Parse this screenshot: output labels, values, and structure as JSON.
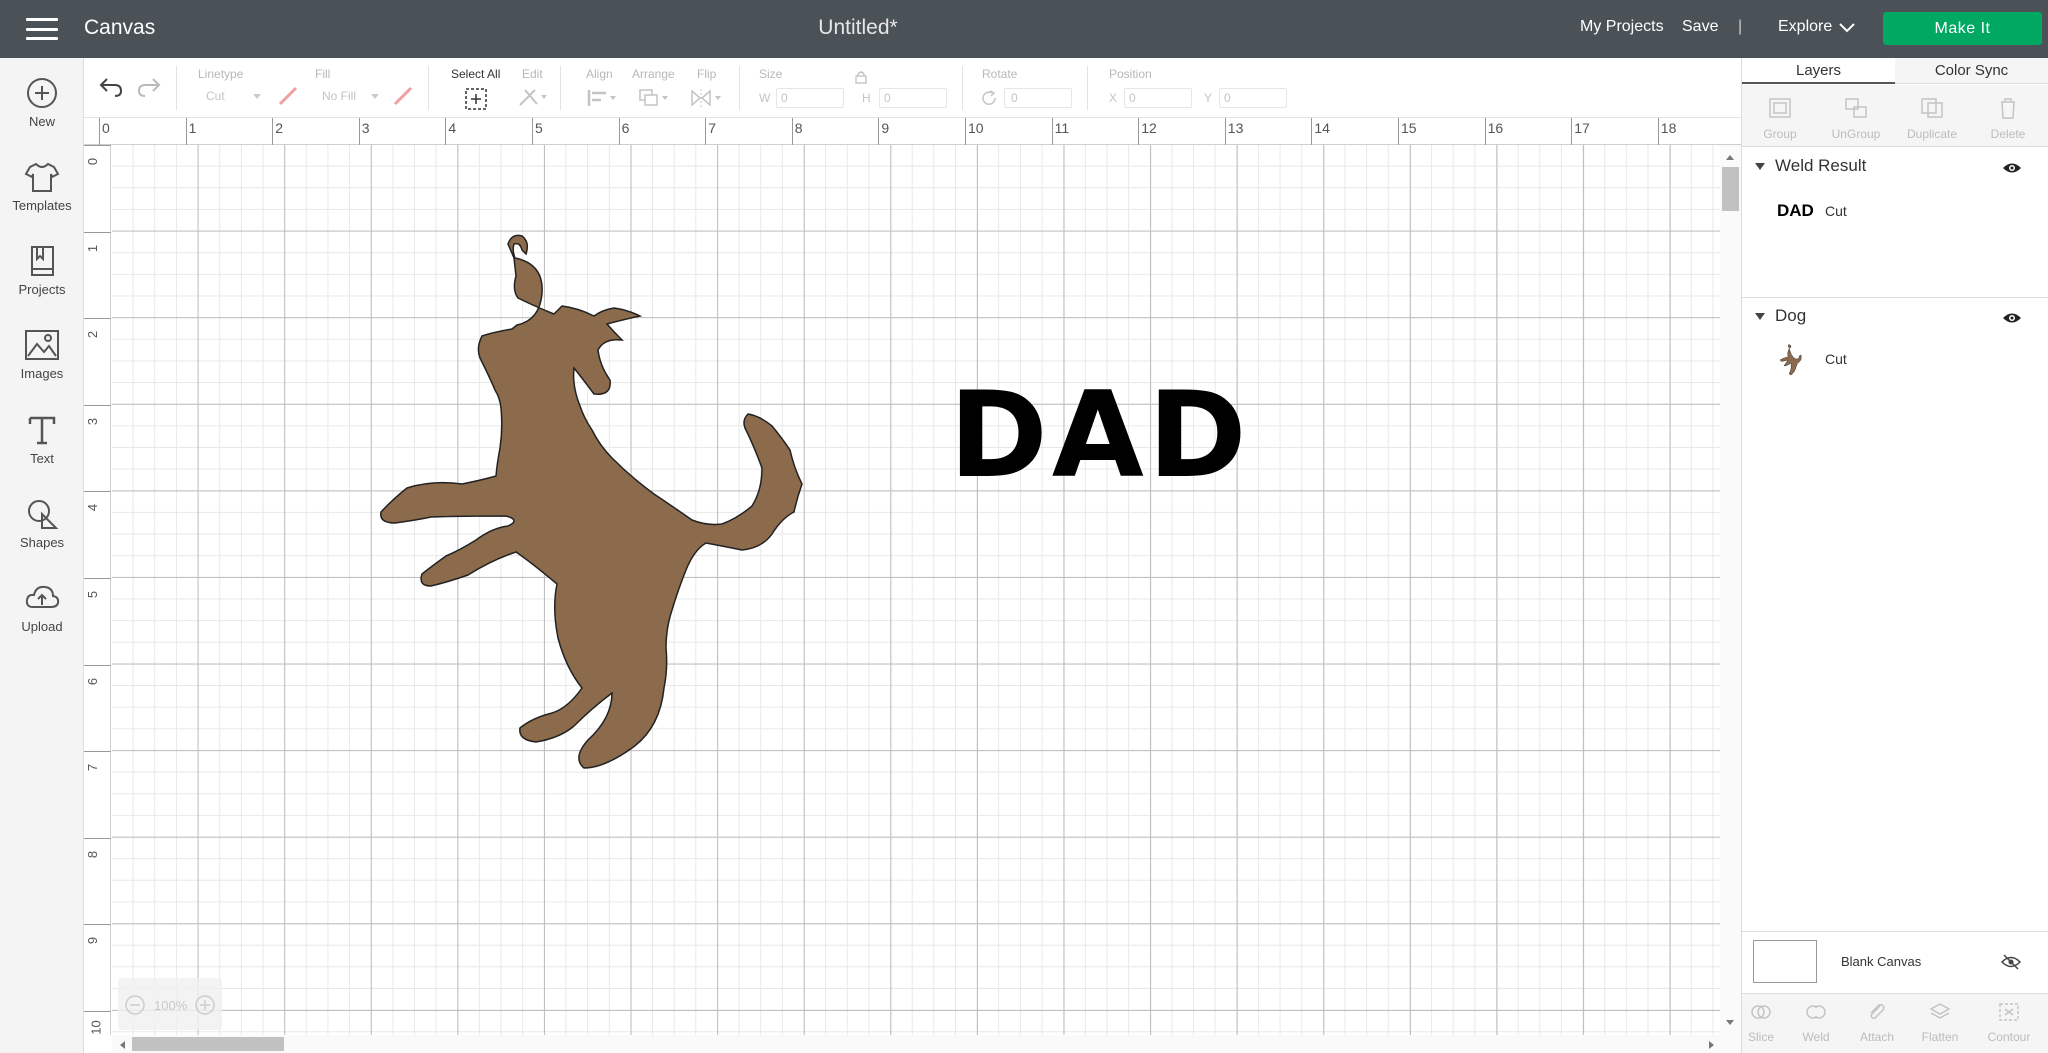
{
  "header": {
    "app_title": "Canvas",
    "doc_title": "Untitled*",
    "my_projects": "My Projects",
    "save": "Save",
    "separator": "|",
    "explore": "Explore",
    "make_it": "Make It"
  },
  "sidebar": {
    "items": [
      {
        "label": "New",
        "icon": "plus-circle-icon"
      },
      {
        "label": "Templates",
        "icon": "shirt-icon"
      },
      {
        "label": "Projects",
        "icon": "bookmark-book-icon"
      },
      {
        "label": "Images",
        "icon": "image-icon"
      },
      {
        "label": "Text",
        "icon": "text-t-icon"
      },
      {
        "label": "Shapes",
        "icon": "shapes-icon"
      },
      {
        "label": "Upload",
        "icon": "cloud-upload-icon"
      }
    ]
  },
  "toolbar": {
    "linetype_label": "Linetype",
    "linetype_value": "Cut",
    "fill_label": "Fill",
    "fill_value": "No Fill",
    "select_all": "Select All",
    "edit": "Edit",
    "align": "Align",
    "arrange": "Arrange",
    "flip": "Flip",
    "size": "Size",
    "w": "W",
    "w_value": "0",
    "h": "H",
    "h_value": "0",
    "rotate": "Rotate",
    "rotate_value": "0",
    "position": "Position",
    "x": "X",
    "x_value": "0",
    "y": "Y",
    "y_value": "0"
  },
  "ruler": {
    "top": [
      "0",
      "1",
      "2",
      "3",
      "4",
      "5",
      "6",
      "7",
      "8",
      "9",
      "10",
      "11",
      "12",
      "13",
      "14",
      "15",
      "16",
      "17",
      "18"
    ],
    "left": [
      "0",
      "1",
      "2",
      "3",
      "4",
      "5",
      "6",
      "7",
      "8",
      "9",
      "10"
    ]
  },
  "canvas": {
    "text_object": "DAD",
    "dog_color": "#8b6b4c"
  },
  "zoom": {
    "value": "100%"
  },
  "panel": {
    "tabs": [
      "Layers",
      "Color Sync"
    ],
    "actions": [
      "Group",
      "UnGroup",
      "Duplicate",
      "Delete"
    ],
    "groups": [
      {
        "title": "Weld Result",
        "layer_thumb": "DAD",
        "layer_label": "Cut"
      },
      {
        "title": "Dog",
        "layer_label": "Cut"
      }
    ],
    "blank_canvas": "Blank Canvas",
    "bottom_actions": [
      "Slice",
      "Weld",
      "Attach",
      "Flatten",
      "Contour"
    ]
  },
  "colors": {
    "topbar": "#4a5157",
    "accent": "#00a862"
  }
}
